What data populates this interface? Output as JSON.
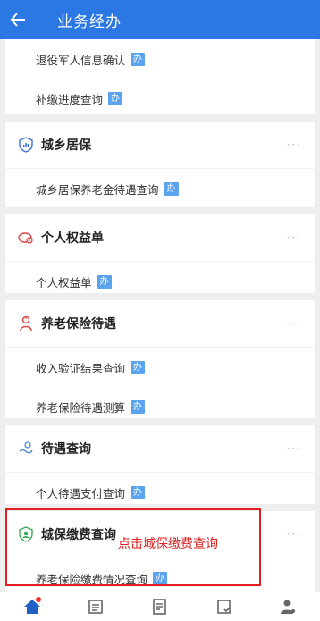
{
  "header": {
    "title": "业务经办"
  },
  "badge_text": "办",
  "top_card": {
    "rows": [
      "退役军人信息确认",
      "补缴进度查询"
    ]
  },
  "sections": [
    {
      "title": "城乡居保",
      "rows": [
        "城乡居保养老金待遇查询"
      ]
    },
    {
      "title": "个人权益单",
      "rows": [
        "个人权益单"
      ]
    },
    {
      "title": "养老保险待遇",
      "rows": [
        "收入验证结果查询",
        "养老保险待遇测算"
      ]
    },
    {
      "title": "待遇查询",
      "rows": [
        "个人待遇支付查询"
      ]
    },
    {
      "title": "城保缴费查询",
      "rows": [
        "养老保险缴费情况查询"
      ]
    }
  ],
  "more_label": "···",
  "annotation": "点击城保缴费查询",
  "colors": {
    "primary": "#2b78e4",
    "badge": "#5aa3ee",
    "highlight": "#e21f1f"
  },
  "tabbar": [
    "home-icon",
    "list-icon",
    "document-icon",
    "checklist-icon",
    "user-icon"
  ]
}
